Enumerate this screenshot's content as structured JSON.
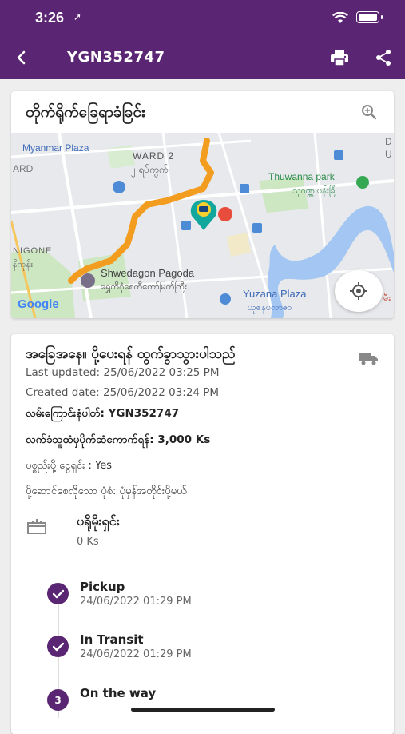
{
  "status_bar": {
    "time": "3:26"
  },
  "app_bar": {
    "title": "YGN352747"
  },
  "map_card": {
    "title": "တိုက်ရိုက်ခြေရာခံခြင်း",
    "labels": {
      "myanmar_plaza": "Myanmar Plaza",
      "ward2": "WARD 2",
      "ward2_mm": "၂ ရပ်ကွက်",
      "thuwanna_park": "Thuwanna park",
      "thuwanna_park_mm": "သုဝဏ္ဏ ပန်းခြံ",
      "shwedagon": "Shwedagon Pagoda",
      "shwedagon_mm": "ရွှေတိဂုံစေတီတော်မြတ်ကြီး",
      "yuzana": "Yuzana Plaza",
      "yuzana_mm": "ယုဇနပလာဇာ",
      "nigone": "NIGONE",
      "nigone_mm": "နီကုန်း",
      "ard": "ARD",
      "google": "Google",
      "edge_d": "D",
      "edge_u": "U",
      "edge_mm": "မီး"
    }
  },
  "detail": {
    "status_title": "အခြေအနေ။ ပို့ပေးရန် ထွက်ခွာသွားပါသည်",
    "last_updated": "Last updated: 25/06/2022 03:25 PM",
    "created_date": "Created date: 25/06/2022 03:24 PM",
    "tracking_no": "လမ်းကြောင်းနံပါတ်: YGN352747",
    "delivery_fee": "လက်ခံသူထံမှပိုက်ဆံကောက်ရန်: 3,000 Ks",
    "prepaid": "ပစ္စည်းပို့ ငွေရှင်း : Yes",
    "delivery_type": "ပို့ဆောင်စေလိုသော ပုံစံ: ပုံမှန်အတိုင်းပို့မယ်",
    "parcel_label": "ပရိုမိုးရှင်း",
    "parcel_value": "0 Ks"
  },
  "timeline": [
    {
      "label": "Pickup",
      "time": "24/06/2022 01:29 PM",
      "done": true
    },
    {
      "label": "In Transit",
      "time": "24/06/2022 01:29 PM",
      "done": true
    },
    {
      "label": "On the way",
      "step": "3",
      "done": false
    }
  ],
  "colors": {
    "brand": "#5a2572",
    "route": "#f29d1f"
  }
}
